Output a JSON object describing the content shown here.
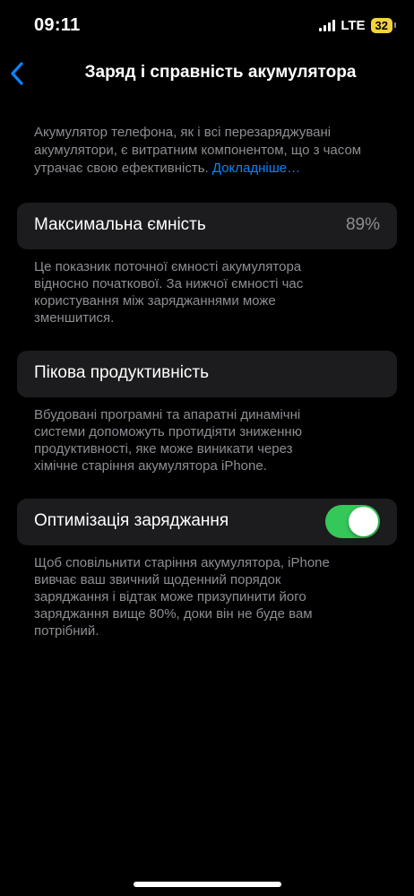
{
  "status_bar": {
    "time": "09:11",
    "network": "LTE",
    "battery_level": "32",
    "icons": [
      "signal-icon",
      "battery-icon"
    ]
  },
  "nav": {
    "back_icon": "chevron-left-icon",
    "title": "Заряд і справність акумулятора"
  },
  "intro": {
    "text": "Акумулятор телефона, як і всі перезаряджувані акумулятори, є витратним компонентом, що з часом утрачає свою ефективність. ",
    "link": "Докладніше…"
  },
  "max_capacity": {
    "label": "Максимальна ємність",
    "value": "89%",
    "footnote": "Це показник поточної ємності акумулятора відносно початкової. За нижчої ємності час користування між заряджаннями може зменшитися."
  },
  "peak_performance": {
    "label": "Пікова продуктивність",
    "footnote": "Вбудовані програмні та апаратні динамічні системи допоможуть протидіяти зниженню продуктивності, яке може виникати через хімічне старіння акумулятора iPhone."
  },
  "optimized_charging": {
    "label": "Оптимізація заряджання",
    "enabled": true,
    "footnote": "Щоб сповільнити старіння акумулятора, iPhone вивчає ваш звичний щоденний порядок заряджання і відтак може призупинити його заряджання вище 80%, доки він не буде вам потрібний."
  },
  "colors": {
    "background": "#000000",
    "card": "#1c1c1e",
    "secondary_text": "#8d8d93",
    "link": "#0a84ff",
    "toggle_on": "#34c759",
    "battery_badge": "#f2d33b"
  }
}
